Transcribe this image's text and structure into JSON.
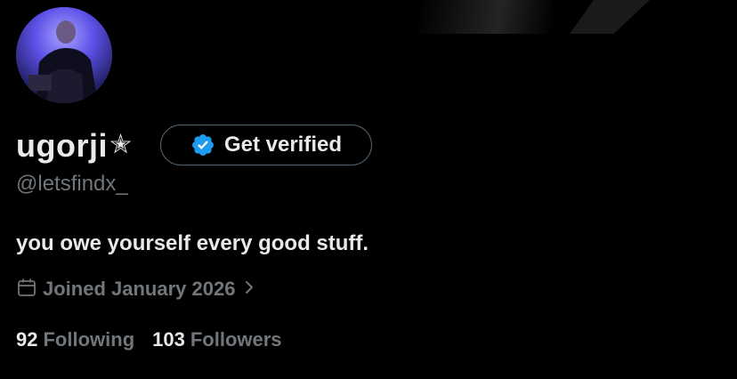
{
  "profile": {
    "display_name": "ugorji",
    "name_emoji": "✭",
    "handle": "@letsfindx_",
    "bio": "you owe yourself every good stuff.",
    "joined": "Joined January 2026"
  },
  "verify": {
    "label": "Get verified",
    "badge_color": "#1d9bf0"
  },
  "stats": {
    "following_count": "92",
    "following_label": "Following",
    "followers_count": "103",
    "followers_label": "Followers"
  },
  "colors": {
    "background": "#000000",
    "primary_text": "#e7e9ea",
    "secondary_text": "#71767b",
    "button_border": "#536471"
  },
  "icons": {
    "calendar": "calendar-icon",
    "chevron": "chevron-right-icon",
    "verified_badge": "verified-badge-icon"
  }
}
